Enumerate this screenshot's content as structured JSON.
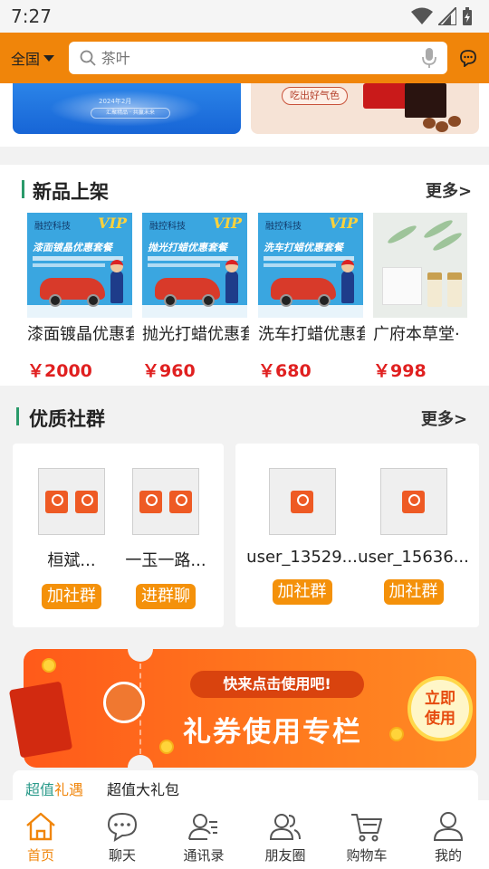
{
  "status_bar": {
    "time": "7:27"
  },
  "header": {
    "region": "全国",
    "search_placeholder": "茶叶"
  },
  "banners": {
    "left_small_text": "2024年2月",
    "left_pill_text": "汇聚精品 · 共赢未来",
    "right_tagline": "吃出好气色"
  },
  "new_products": {
    "title": "新品上架",
    "more": "更多>",
    "items": [
      {
        "thumb_brand": "融控科技",
        "thumb_vip": "VIP",
        "thumb_title": "漆面镀晶优惠套餐",
        "name": "漆面镀晶优惠套餐",
        "price": "￥2000"
      },
      {
        "thumb_brand": "融控科技",
        "thumb_vip": "VIP",
        "thumb_title": "抛光打蜡优惠套餐",
        "name": "抛光打蜡优惠套餐",
        "price": "￥960"
      },
      {
        "thumb_brand": "融控科技",
        "thumb_vip": "VIP",
        "thumb_title": "洗车打蜡优惠套餐",
        "name": "洗车打蜡优惠套餐",
        "price": "￥680"
      },
      {
        "name": "广府本草堂·",
        "price": "￥998"
      }
    ]
  },
  "communities": {
    "title": "优质社群",
    "more": "更多>",
    "cards": [
      {
        "members": [
          {
            "name": "桓斌...",
            "button": "加社群"
          },
          {
            "name": "一玉一路...",
            "button": "进群聊"
          }
        ]
      },
      {
        "members": [
          {
            "name": "user_13529...",
            "button": "加社群"
          },
          {
            "name": "user_15636...",
            "button": "加社群"
          }
        ]
      }
    ]
  },
  "coupon": {
    "headline": "快来点击使用吧!",
    "title": "礼券使用专栏",
    "use_button_line1": "立即",
    "use_button_line2": "使用"
  },
  "gift_tabs": {
    "tab1_part_a": "超值",
    "tab1_part_b": "礼遇",
    "tab2": "超值大礼包"
  },
  "bottom_nav": {
    "items": [
      {
        "label": "首页",
        "icon": "home-icon",
        "active": true
      },
      {
        "label": "聊天",
        "icon": "chat-bubble-icon"
      },
      {
        "label": "通讯录",
        "icon": "contacts-icon"
      },
      {
        "label": "朋友圈",
        "icon": "friends-icon"
      },
      {
        "label": "购物车",
        "icon": "cart-icon"
      },
      {
        "label": "我的",
        "icon": "profile-icon"
      }
    ]
  },
  "colors": {
    "brand_orange": "#f0850a",
    "price_red": "#e02020",
    "accent_green": "#2a9a6a"
  }
}
